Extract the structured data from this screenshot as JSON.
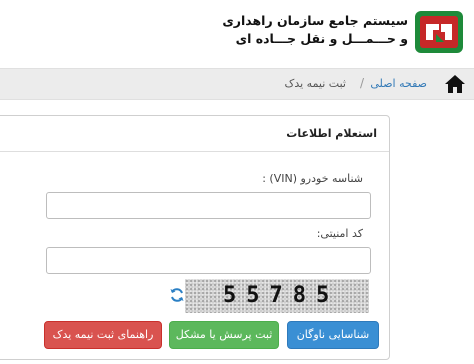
{
  "header": {
    "title_line1": "سیستم جامع سازمان راهداری",
    "title_line2": "و حـــمـــل و نقل جـــاده ای"
  },
  "breadcrumb": {
    "home": "صفحه اصلی",
    "separator": "/",
    "current": "ثبت نیمه یدک"
  },
  "panel": {
    "title": "استعلام اطلاعات",
    "vin_label": "شناسه خودرو (VIN) :",
    "vin_value": "",
    "security_label": "کد امنیتی:",
    "security_value": "",
    "captcha_text": "55785"
  },
  "buttons": {
    "primary": "شناسایی ناوگان",
    "success": "ثبت پرسش یا مشکل",
    "danger": "راهنمای ثبت نیمه یدک"
  },
  "colors": {
    "primary": "#3a8fd4",
    "success": "#5cb85c",
    "danger": "#d9534f",
    "link": "#337ab7"
  },
  "icons": [
    "rmto-logo-icon",
    "home-icon",
    "refresh-icon"
  ]
}
